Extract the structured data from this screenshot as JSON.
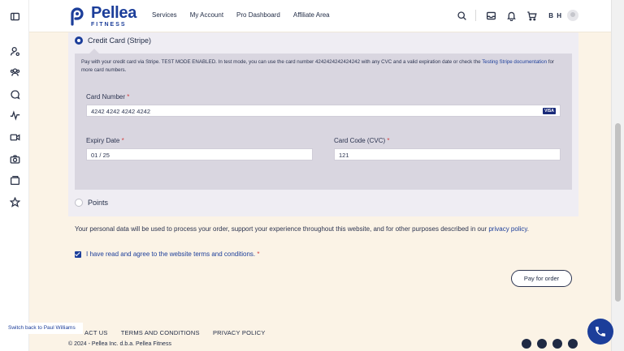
{
  "brand": {
    "name": "Pellea",
    "sub": "FITNESS",
    "color": "#1c3e9a"
  },
  "nav": [
    "Services",
    "My Account",
    "Pro Dashboard",
    "Affiliate Area"
  ],
  "user": {
    "initials": "B H"
  },
  "sidebar_icons": [
    "panel-icon",
    "user-settings-icon",
    "users-icon",
    "chat-icon",
    "activity-icon",
    "video-icon",
    "camera-icon",
    "folder-icon",
    "star-icon"
  ],
  "payment": {
    "stripe_label": "Credit Card (Stripe)",
    "notice_text": "Pay with your credit card via Stripe. TEST MODE ENABLED. In test mode, you can use the card number 4242424242424242 with any CVC and a valid expiration date or check the",
    "notice_link": "Testing Stripe documentation",
    "notice_after": "for more card numbers.",
    "card_number_label": "Card Number",
    "card_number_value": "4242 4242 4242 4242",
    "card_brand": "VISA",
    "expiry_label": "Expiry Date",
    "expiry_value": "01 / 25",
    "cvc_label": "Card Code (CVC)",
    "cvc_value": "121",
    "required_mark": "*",
    "points_label": "Points"
  },
  "privacy": {
    "text": "Your personal data will be used to process your order, support your experience throughout this website, and for other purposes described in our",
    "link": "privacy policy",
    "end": "."
  },
  "terms": {
    "text": "I have read and agree to the website terms and conditions.",
    "required_mark": "*"
  },
  "pay_button": "Pay for order",
  "switch_back": "Switch back to Paul Williams",
  "footer": {
    "links": [
      "ACT US",
      "TERMS AND CONDITIONS",
      "PRIVACY POLICY"
    ],
    "copyright": "© 2024 - Pellea Inc. d.b.a. Pellea Fitness"
  }
}
